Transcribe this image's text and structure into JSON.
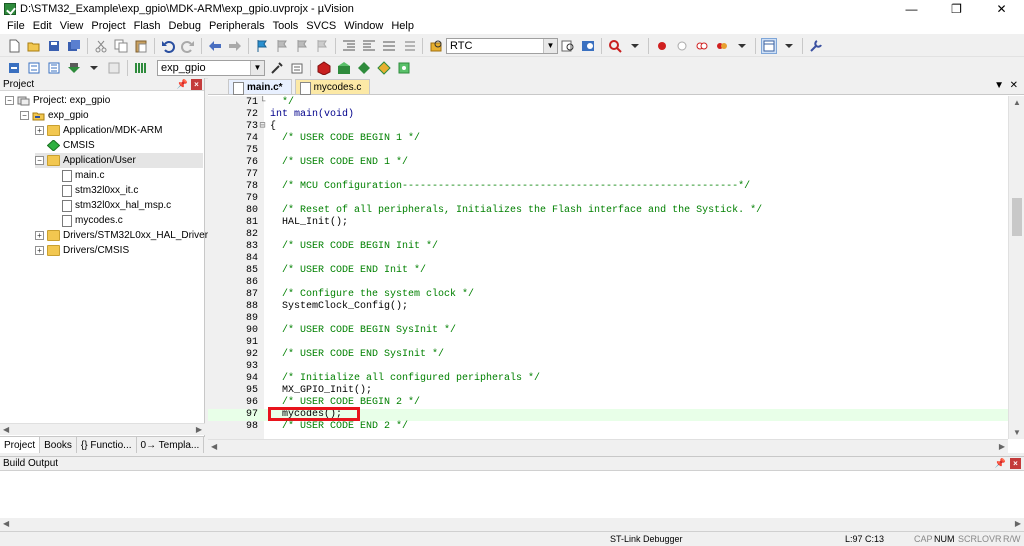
{
  "window": {
    "title": "D:\\STM32_Example\\exp_gpio\\MDK-ARM\\exp_gpio.uvprojx - µVision",
    "minimize": "—",
    "maximize": "❐",
    "close": "✕"
  },
  "menu": [
    "File",
    "Edit",
    "View",
    "Project",
    "Flash",
    "Debug",
    "Peripherals",
    "Tools",
    "SVCS",
    "Window",
    "Help"
  ],
  "toolbar": {
    "find_combo": "RTC",
    "target_combo": "exp_gpio"
  },
  "project_panel": {
    "title": "Project",
    "tree": [
      {
        "label": "Project: exp_gpio",
        "level": 0,
        "kind": "root",
        "expander": "−"
      },
      {
        "label": "exp_gpio",
        "level": 1,
        "kind": "target",
        "expander": "−"
      },
      {
        "label": "Application/MDK-ARM",
        "level": 2,
        "kind": "folder",
        "expander": "+"
      },
      {
        "label": "CMSIS",
        "level": 2,
        "kind": "cmsis",
        "expander": ""
      },
      {
        "label": "Application/User",
        "level": 2,
        "kind": "folder",
        "expander": "−"
      },
      {
        "label": "main.c",
        "level": 3,
        "kind": "file",
        "expander": ""
      },
      {
        "label": "stm32l0xx_it.c",
        "level": 3,
        "kind": "file",
        "expander": ""
      },
      {
        "label": "stm32l0xx_hal_msp.c",
        "level": 3,
        "kind": "file",
        "expander": ""
      },
      {
        "label": "mycodes.c",
        "level": 3,
        "kind": "file",
        "expander": ""
      },
      {
        "label": "Drivers/STM32L0xx_HAL_Driver",
        "level": 2,
        "kind": "folder",
        "expander": "+"
      },
      {
        "label": "Drivers/CMSIS",
        "level": 2,
        "kind": "folder",
        "expander": "+"
      }
    ],
    "tabs": [
      "Project",
      "Books",
      "{} Functio...",
      "0→ Templa..."
    ]
  },
  "editor": {
    "tabs": [
      {
        "label": "main.c*",
        "active": true
      },
      {
        "label": "mycodes.c",
        "active": false
      }
    ],
    "lines": [
      {
        "num": "71",
        "fold": "└",
        "text": "  */",
        "style": "cm"
      },
      {
        "num": "72",
        "fold": "",
        "text": "int main(void)",
        "style": "kw"
      },
      {
        "num": "73",
        "fold": "⊟",
        "text": "{",
        "style": ""
      },
      {
        "num": "74",
        "fold": "",
        "text": "  /* USER CODE BEGIN 1 */",
        "style": "cm"
      },
      {
        "num": "75",
        "fold": "",
        "text": "",
        "style": ""
      },
      {
        "num": "76",
        "fold": "",
        "text": "  /* USER CODE END 1 */",
        "style": "cm"
      },
      {
        "num": "77",
        "fold": "",
        "text": "",
        "style": ""
      },
      {
        "num": "78",
        "fold": "",
        "text": "  /* MCU Configuration--------------------------------------------------------*/",
        "style": "cm"
      },
      {
        "num": "79",
        "fold": "",
        "text": "",
        "style": ""
      },
      {
        "num": "80",
        "fold": "",
        "text": "  /* Reset of all peripherals, Initializes the Flash interface and the Systick. */",
        "style": "cm"
      },
      {
        "num": "81",
        "fold": "",
        "text": "  HAL_Init();",
        "style": ""
      },
      {
        "num": "82",
        "fold": "",
        "text": "",
        "style": ""
      },
      {
        "num": "83",
        "fold": "",
        "text": "  /* USER CODE BEGIN Init */",
        "style": "cm"
      },
      {
        "num": "84",
        "fold": "",
        "text": "",
        "style": ""
      },
      {
        "num": "85",
        "fold": "",
        "text": "  /* USER CODE END Init */",
        "style": "cm"
      },
      {
        "num": "86",
        "fold": "",
        "text": "",
        "style": ""
      },
      {
        "num": "87",
        "fold": "",
        "text": "  /* Configure the system clock */",
        "style": "cm"
      },
      {
        "num": "88",
        "fold": "",
        "text": "  SystemClock_Config();",
        "style": ""
      },
      {
        "num": "89",
        "fold": "",
        "text": "",
        "style": ""
      },
      {
        "num": "90",
        "fold": "",
        "text": "  /* USER CODE BEGIN SysInit */",
        "style": "cm"
      },
      {
        "num": "91",
        "fold": "",
        "text": "",
        "style": ""
      },
      {
        "num": "92",
        "fold": "",
        "text": "  /* USER CODE END SysInit */",
        "style": "cm"
      },
      {
        "num": "93",
        "fold": "",
        "text": "",
        "style": ""
      },
      {
        "num": "94",
        "fold": "",
        "text": "  /* Initialize all configured peripherals */",
        "style": "cm"
      },
      {
        "num": "95",
        "fold": "",
        "text": "  MX_GPIO_Init();",
        "style": ""
      },
      {
        "num": "96",
        "fold": "",
        "text": "  /* USER CODE BEGIN 2 */",
        "style": "cm"
      },
      {
        "num": "97",
        "fold": "",
        "text": "  mycodes();",
        "style": "",
        "current": true
      },
      {
        "num": "98",
        "fold": "",
        "text": "  /* USER CODE END 2 */",
        "style": "cm"
      }
    ]
  },
  "build_output": {
    "title": "Build Output"
  },
  "status": {
    "debugger": "ST-Link Debugger",
    "position": "L:97 C:13",
    "cap": "CAP",
    "num": "NUM",
    "scrl": "SCRL",
    "ovr": "OVR",
    "rw": "R/W"
  },
  "colors": {
    "highlight_box": "#e8141c",
    "comment": "#008000",
    "keyword": "#00008b",
    "current_line": "#e8ffe8"
  }
}
